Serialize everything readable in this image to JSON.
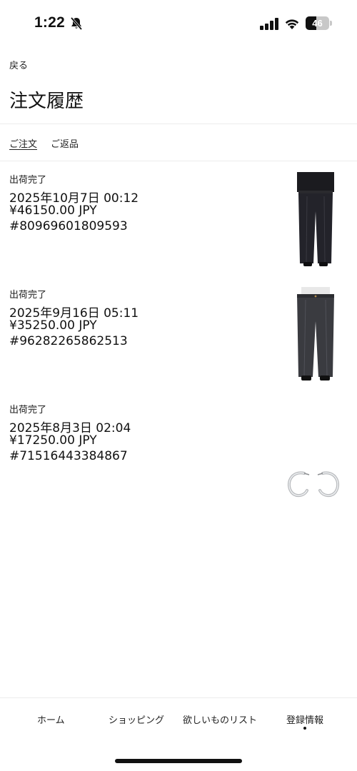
{
  "status_bar": {
    "time": "1:22",
    "battery": "46",
    "battery_level_percent": 46,
    "icons": [
      "bell-slash-icon",
      "cellular-signal-icon",
      "wifi-icon",
      "battery-icon"
    ]
  },
  "header": {
    "back_label": "戻る",
    "title": "注文履歴"
  },
  "tabs": [
    {
      "label": "ご注文",
      "active": true
    },
    {
      "label": "ご返品",
      "active": false
    }
  ],
  "orders": [
    {
      "status": "出荷完了",
      "date": "2025年10月7日 00:12",
      "price": "¥46150.00 JPY",
      "order_number": "#80969601809593",
      "image": "black-trousers"
    },
    {
      "status": "出荷完了",
      "date": "2025年9月16日 05:11",
      "price": "¥35250.00 JPY",
      "order_number": "#96282265862513",
      "image": "black-jeans"
    },
    {
      "status": "出荷完了",
      "date": "2025年8月3日 02:04",
      "price": "¥17250.00 JPY",
      "order_number": "#71516443384867",
      "image": "silver-hoop-earrings"
    }
  ],
  "bottom_nav": {
    "items": [
      {
        "label": "ホーム",
        "active": false
      },
      {
        "label": "ショッピング",
        "active": false
      },
      {
        "label": "欲しいものリスト",
        "active": false
      },
      {
        "label": "登録情報",
        "active": true
      }
    ]
  },
  "colors": {
    "text": "#111111",
    "divider": "#ececec",
    "background": "#ffffff"
  }
}
